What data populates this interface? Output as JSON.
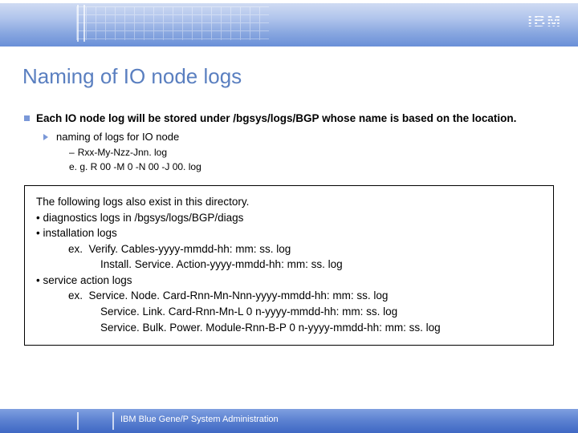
{
  "header": {
    "logo": "IBM"
  },
  "title": "Naming of IO node logs",
  "main_bullet": "Each IO node log will be stored under /bgsys/logs/BGP whose name is based on the location.",
  "sub_bullet": "naming of logs for IO node",
  "pattern_line": "Rxx-My-Nzz-Jnn. log",
  "example_line": "e. g. R 00 -M 0 -N 00 -J 00. log",
  "box": {
    "intro": "The following logs also exist in this directory.",
    "l1": "• diagnostics logs in /bgsys/logs/BGP/diags",
    "l2": "• installation logs",
    "l3": "ex.  Verify. Cables-yyyy-mmdd-hh: mm: ss. log",
    "l4": "Install. Service. Action-yyyy-mmdd-hh: mm: ss. log",
    "l5": "• service action logs",
    "l6": "ex.  Service. Node. Card-Rnn-Mn-Nnn-yyyy-mmdd-hh: mm: ss. log",
    "l7": "Service. Link. Card-Rnn-Mn-L 0 n-yyyy-mmdd-hh: mm: ss. log",
    "l8": "Service. Bulk. Power. Module-Rnn-B-P 0 n-yyyy-mmdd-hh: mm: ss. log"
  },
  "footer": "IBM Blue Gene/P System Administration"
}
